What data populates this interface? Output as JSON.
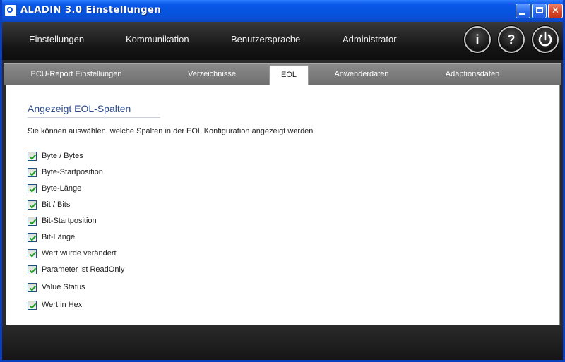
{
  "window": {
    "title": "ALADIN  3.0  Einstellungen",
    "buttons": {
      "minimize": "minimize-icon",
      "maximize": "maximize-icon",
      "close": "close-icon"
    }
  },
  "menu": {
    "items": [
      {
        "label": "Einstellungen"
      },
      {
        "label": "Kommunikation"
      },
      {
        "label": "Benutzersprache"
      },
      {
        "label": "Administrator"
      }
    ],
    "round_buttons": [
      {
        "glyph": "i",
        "icon": "info-icon"
      },
      {
        "glyph": "?",
        "icon": "help-icon"
      },
      {
        "glyph": "⏻",
        "icon": "power-icon"
      }
    ]
  },
  "tabs": [
    {
      "label": "ECU-Report Einstellungen",
      "active": false
    },
    {
      "label": "Verzeichnisse",
      "active": false
    },
    {
      "label": "EOL",
      "active": true
    },
    {
      "label": "Anwenderdaten",
      "active": false
    },
    {
      "label": "Adaptionsdaten",
      "active": false
    }
  ],
  "section": {
    "title": "Angezeigt EOL-Spalten",
    "description": "Sie können auswählen, welche Spalten in der EOL Konfiguration angezeigt werden"
  },
  "columns": [
    {
      "label": "Byte / Bytes",
      "checked": true
    },
    {
      "label": "Byte-Startposition",
      "checked": true
    },
    {
      "label": "Byte-Länge",
      "checked": true
    },
    {
      "label": "Bit / Bits",
      "checked": true
    },
    {
      "label": "Bit-Startposition",
      "checked": true
    },
    {
      "label": "Bit-Länge",
      "checked": true
    },
    {
      "label": "Wert wurde verändert",
      "checked": true
    },
    {
      "label": "Parameter ist ReadOnly",
      "checked": true
    },
    {
      "label": "Value Status",
      "checked": true
    },
    {
      "label": "Wert in Hex",
      "checked": true
    }
  ],
  "colors": {
    "titlebar": "#0653dd",
    "check": "#21a121",
    "section_title": "#2c4a8e"
  }
}
